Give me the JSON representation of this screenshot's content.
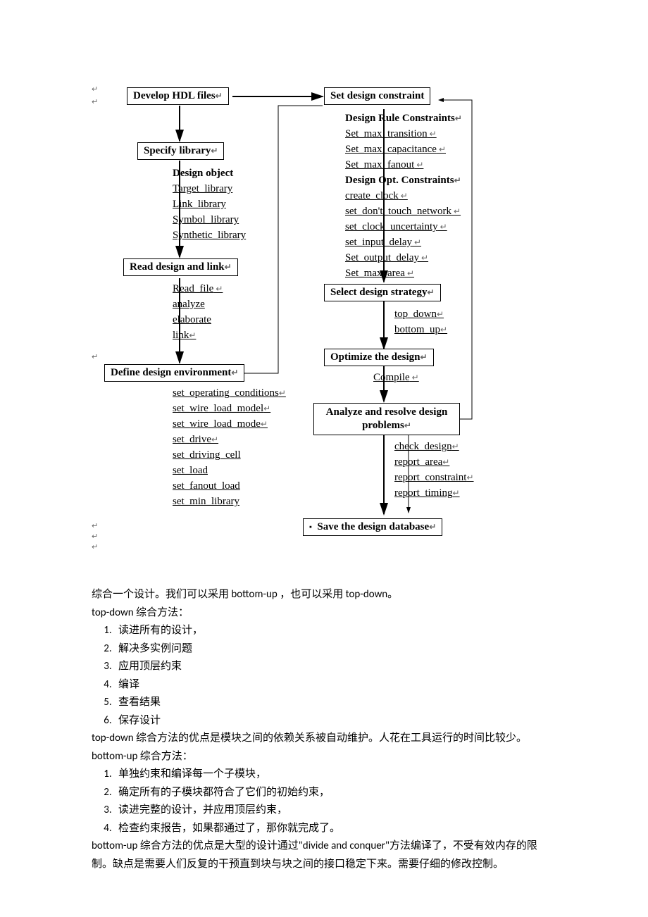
{
  "diagram": {
    "box1": "Develop HDL files",
    "box2": "Specify library",
    "box2_h": "Design object",
    "box2_items": [
      "Target_library",
      "Link_library",
      "Symbol_library",
      "Synthetic_library"
    ],
    "box3": "Read design and link",
    "box3_items": [
      "Read_file",
      "analyze",
      "elaborate",
      "link"
    ],
    "box4": "Define design environment",
    "box4_items": [
      "set_operating_conditions",
      "set_wire_load_model",
      "set_wire_load_mode",
      "set_drive",
      "set_driving_cell",
      "set_load",
      "set_fanout_load",
      "set_min_library"
    ],
    "box5": "Set design constraint",
    "box5_h1": "Design Rule Constraints",
    "box5_items1": [
      "Set_max_transition",
      "Set_max_capacitance",
      "Set_max_fanout"
    ],
    "box5_h2": "Design Opt. Constraints",
    "box5_items2": [
      "create_clock",
      "set_don't_touch_network",
      "set_clock_uncertainty",
      "set_input_delay",
      "Set_output_delay",
      "Set_max_area"
    ],
    "box6": "Select design strategy",
    "box6_items": [
      "top_down",
      "bottom_up"
    ],
    "box7": "Optimize the design",
    "box7_items": [
      "Compile"
    ],
    "box8a": "Analyze and resolve design",
    "box8b": "problems",
    "box8_items": [
      "check_design",
      "report_area",
      "report_constraint",
      "report_timing"
    ],
    "box9": "Save the design database"
  },
  "text": {
    "p1": "综合一个设计。我们可以采用 bottom-up ，也可以采用 top-down。",
    "p2": "top-down 综合方法：",
    "td": [
      "读进所有的设计，",
      "解决多实例问题",
      "应用顶层约束",
      "编译",
      "查看结果",
      "保存设计"
    ],
    "p3": "top-down 综合方法的优点是模块之间的依赖关系被自动维护。人花在工具运行的时间比较少。",
    "p4": "bottom-up 综合方法：",
    "bu": [
      "单独约束和编译每一个子模块，",
      "确定所有的子模块都符合了它们的初始约束，",
      "读进完整的设计，并应用顶层约束，",
      "检查约束报告，如果都通过了，那你就完成了。"
    ],
    "p5": "bottom-up 综合方法的优点是大型的设计通过\"divide and conquer\"方法编译了，不受有效内存的限制。缺点是需要人们反复的干预直到块与块之间的接口稳定下来。需要仔细的修改控制。"
  }
}
